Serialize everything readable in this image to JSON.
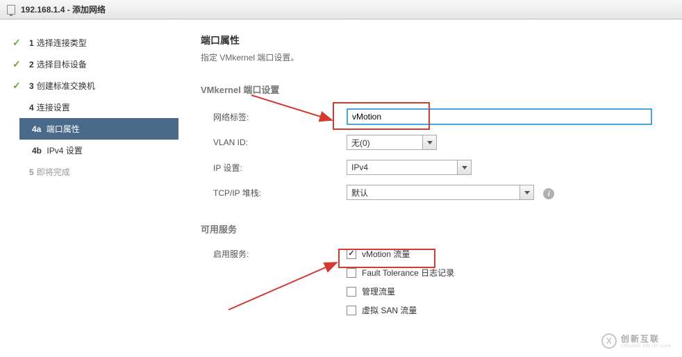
{
  "titlebar": {
    "title": "192.168.1.4 - 添加网络"
  },
  "sidebar": {
    "steps": [
      {
        "num": "1",
        "label": "选择连接类型",
        "done": true
      },
      {
        "num": "2",
        "label": "选择目标设备",
        "done": true
      },
      {
        "num": "3",
        "label": "创建标准交换机",
        "done": true
      },
      {
        "num": "4",
        "label": "连接设置",
        "done": false
      },
      {
        "num": "4a",
        "label": "端口属性",
        "sub": true,
        "active": true
      },
      {
        "num": "4b",
        "label": "IPv4 设置",
        "sub": true
      },
      {
        "num": "5",
        "label": "即将完成",
        "disabled": true
      }
    ]
  },
  "main": {
    "heading": "端口属性",
    "subheading": "指定 VMkernel 端口设置。",
    "section_vmkernel": "VMkernel 端口设置",
    "labels": {
      "network_label": "网络标签:",
      "vlan_id": "VLAN ID:",
      "ip_settings": "IP 设置:",
      "tcpip_stack": "TCP/IP 堆栈:"
    },
    "values": {
      "network_label": "vMotion",
      "vlan_id": "无(0)",
      "ip_settings": "IPv4",
      "tcpip_stack": "默认"
    },
    "section_services": "可用服务",
    "label_enable_services": "启用服务:",
    "services": [
      {
        "label": "vMotion 流量",
        "checked": true
      },
      {
        "label": "Fault Tolerance 日志记录",
        "checked": false
      },
      {
        "label": "管理流量",
        "checked": false
      },
      {
        "label": "虚拟 SAN 流量",
        "checked": false
      }
    ]
  },
  "watermark": {
    "brand": "创新互联",
    "pinyin": "CHUANG XIN HU LIAN"
  }
}
